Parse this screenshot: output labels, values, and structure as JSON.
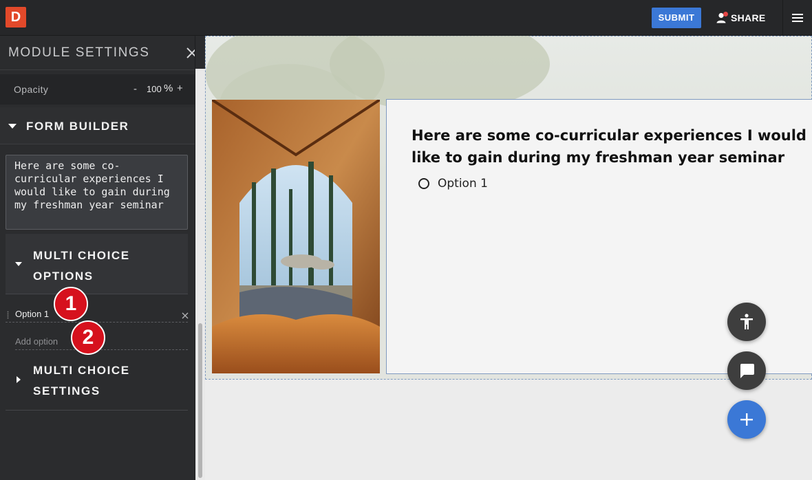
{
  "app": {
    "logo_letter": "D",
    "submit_label": "SUBMIT",
    "share_label": "SHARE",
    "accent_color": "#3b78d6",
    "logo_color": "#e2492a"
  },
  "sidebar": {
    "title": "MODULE SETTINGS",
    "opacity": {
      "label": "Opacity",
      "minus": "-",
      "value": "100",
      "unit": "%",
      "plus": "+"
    },
    "form_builder_label": "FORM BUILDER",
    "question_text": "Here are some co-curricular experiences I would like to gain during my freshman year seminar",
    "multi_choice_options_label": "MULTI CHOICE OPTIONS",
    "options": [
      "Option 1"
    ],
    "add_option_placeholder": "Add option",
    "multi_choice_settings_label": "MULTI CHOICE SETTINGS",
    "badges": [
      "1",
      "2"
    ]
  },
  "canvas": {
    "question": "Here are some co-curricular experiences I would like to gain during my freshman year seminar",
    "options": [
      "Option 1"
    ]
  },
  "icons": [
    "close-icon",
    "person-icon",
    "hamburger-menu-icon",
    "caret-down-icon",
    "caret-right-icon",
    "drag-handle-icon",
    "remove-icon",
    "accessibility-icon",
    "chat-icon",
    "plus-icon"
  ]
}
